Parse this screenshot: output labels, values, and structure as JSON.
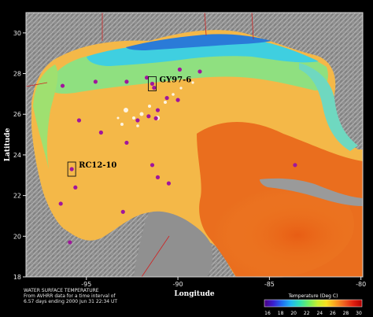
{
  "map": {
    "x_axis": {
      "title": "Longitude",
      "ticks": [
        {
          "value": -95,
          "label": "-95"
        },
        {
          "value": -90,
          "label": "-90"
        },
        {
          "value": -85,
          "label": "-85"
        },
        {
          "value": -80,
          "label": "-80"
        }
      ]
    },
    "y_axis": {
      "title": "Latitude",
      "ticks": [
        {
          "value": 30,
          "label": "30"
        },
        {
          "value": 28,
          "label": "28"
        },
        {
          "value": 26,
          "label": "26"
        },
        {
          "value": 24,
          "label": "24"
        },
        {
          "value": 22,
          "label": "22"
        },
        {
          "value": 20,
          "label": "20"
        },
        {
          "value": 18,
          "label": "18"
        }
      ]
    },
    "sites": [
      {
        "label": "GY97-6",
        "lon": -91.4,
        "lat": 27.5
      },
      {
        "label": "RC12-10",
        "lon": -95.8,
        "lat": 23.3
      }
    ],
    "stations": [
      {
        "lon": -91.7,
        "lat": 27.8
      },
      {
        "lon": -89.9,
        "lat": 28.2
      },
      {
        "lon": -88.8,
        "lat": 28.1
      },
      {
        "lon": -92.8,
        "lat": 27.6
      },
      {
        "lon": -96.3,
        "lat": 27.4
      },
      {
        "lon": -94.5,
        "lat": 27.6
      },
      {
        "lon": -91.3,
        "lat": 27.3
      },
      {
        "lon": -90.6,
        "lat": 26.8
      },
      {
        "lon": -90.0,
        "lat": 26.7
      },
      {
        "lon": -91.1,
        "lat": 26.2
      },
      {
        "lon": -91.6,
        "lat": 25.9
      },
      {
        "lon": -92.2,
        "lat": 25.7
      },
      {
        "lon": -91.2,
        "lat": 25.8
      },
      {
        "lon": -95.4,
        "lat": 25.7
      },
      {
        "lon": -94.2,
        "lat": 25.1
      },
      {
        "lon": -92.8,
        "lat": 24.6
      },
      {
        "lon": -91.4,
        "lat": 23.5
      },
      {
        "lon": -91.1,
        "lat": 22.9
      },
      {
        "lon": -90.5,
        "lat": 22.6
      },
      {
        "lon": -95.6,
        "lat": 22.4
      },
      {
        "lon": -96.4,
        "lat": 21.6
      },
      {
        "lon": -93.0,
        "lat": 21.2
      },
      {
        "lon": -95.9,
        "lat": 19.7
      },
      {
        "lon": -83.6,
        "lat": 23.5
      }
    ],
    "caption_lines": [
      "WATER SURFACE TEMPERATURE",
      "From AVHRR data for a time interval of",
      "6.57 days ending 2000 Jun 31 22:34 UT"
    ],
    "colorbar": {
      "title": "Temperature (Deg C)",
      "ticks": [
        "16",
        "18",
        "20",
        "22",
        "24",
        "26",
        "28",
        "30"
      ],
      "colors": [
        "#4b0082",
        "#3a1fd0",
        "#1f6ff0",
        "#20b8f0",
        "#30e0b0",
        "#70f060",
        "#c8f030",
        "#f8e020",
        "#f8a020",
        "#f06020",
        "#e02010",
        "#b00000"
      ]
    },
    "colors": {
      "ocean_warm": "#f2a43c",
      "ocean_hot": "#e96b1f",
      "ocean_mid": "#f7c34a",
      "shelf_green": "#7fe07a",
      "shelf_cyan": "#3fd0d8",
      "land": "#8a8a8a",
      "station": "#a0169c"
    }
  }
}
